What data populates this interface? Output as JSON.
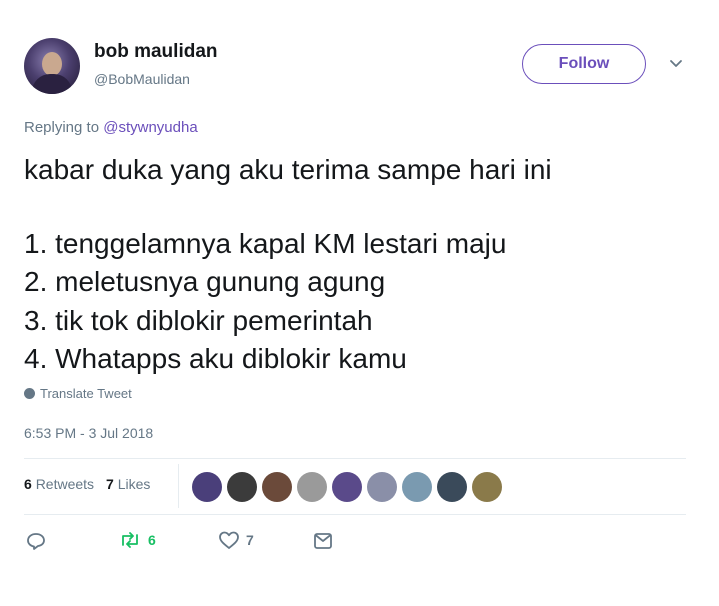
{
  "user": {
    "display_name": "bob maulidan",
    "handle": "@BobMaulidan"
  },
  "follow_button": {
    "label": "Follow"
  },
  "reply": {
    "prefix": "Replying to ",
    "mention": "@stywnyudha"
  },
  "tweet": {
    "lines": [
      "kabar duka yang aku terima sampe hari ini",
      "1. tenggelamnya kapal KM lestari maju",
      "2. meletusnya gunung agung",
      "3. tik tok diblokir pemerintah",
      "4. Whatapps aku diblokir kamu"
    ]
  },
  "translate": {
    "label": "Translate Tweet"
  },
  "timestamp": "6:53 PM - 3 Jul 2018",
  "stats": {
    "retweets_count": "6",
    "retweets_label": "Retweets",
    "likes_count": "7",
    "likes_label": "Likes"
  },
  "likers": [
    {
      "color": "#4a3f7a"
    },
    {
      "color": "#3b3b3b"
    },
    {
      "color": "#6b4a3a"
    },
    {
      "color": "#9a9a9a"
    },
    {
      "color": "#5a4a8a"
    },
    {
      "color": "#8a8fa8"
    },
    {
      "color": "#7a9ab0"
    },
    {
      "color": "#3a4a5a"
    },
    {
      "color": "#8a7a4a"
    }
  ],
  "actions": {
    "retweet_count": "6",
    "like_count": "7"
  },
  "colors": {
    "accent": "#6b4fbb",
    "retweet_green": "#17bf63",
    "muted": "#657786"
  }
}
